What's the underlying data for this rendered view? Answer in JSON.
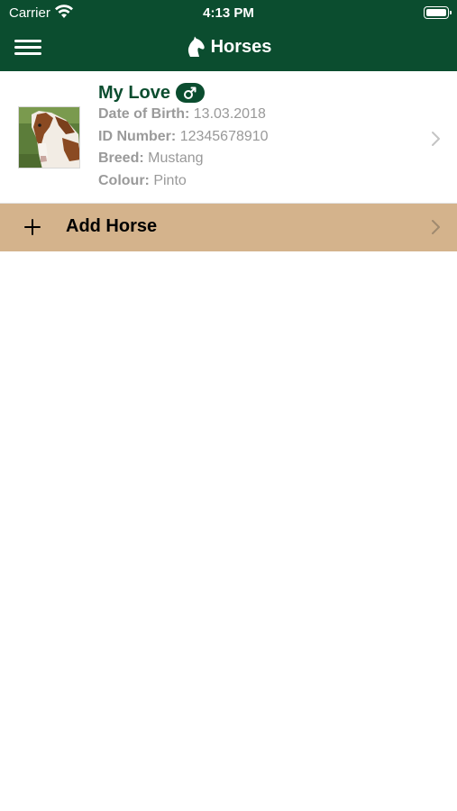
{
  "status_bar": {
    "carrier": "Carrier",
    "time": "4:13 PM"
  },
  "nav": {
    "title": "Horses",
    "menu_icon": "hamburger-menu-icon",
    "title_icon": "horse-head-icon"
  },
  "horses": [
    {
      "name": "My Love",
      "gender_icon": "male-symbol-icon",
      "dob_label": "Date of Birth:",
      "dob_value": "13.03.2018",
      "id_label": "ID Number:",
      "id_value": "12345678910",
      "breed_label": "Breed:",
      "breed_value": "Mustang",
      "colour_label": "Colour:",
      "colour_value": "Pinto"
    }
  ],
  "add_horse": {
    "label": "Add Horse",
    "icon": "plus-icon"
  },
  "colors": {
    "brand_green": "#0b4d2f",
    "add_row_tan": "#d4b38c",
    "detail_grey": "#999999"
  }
}
